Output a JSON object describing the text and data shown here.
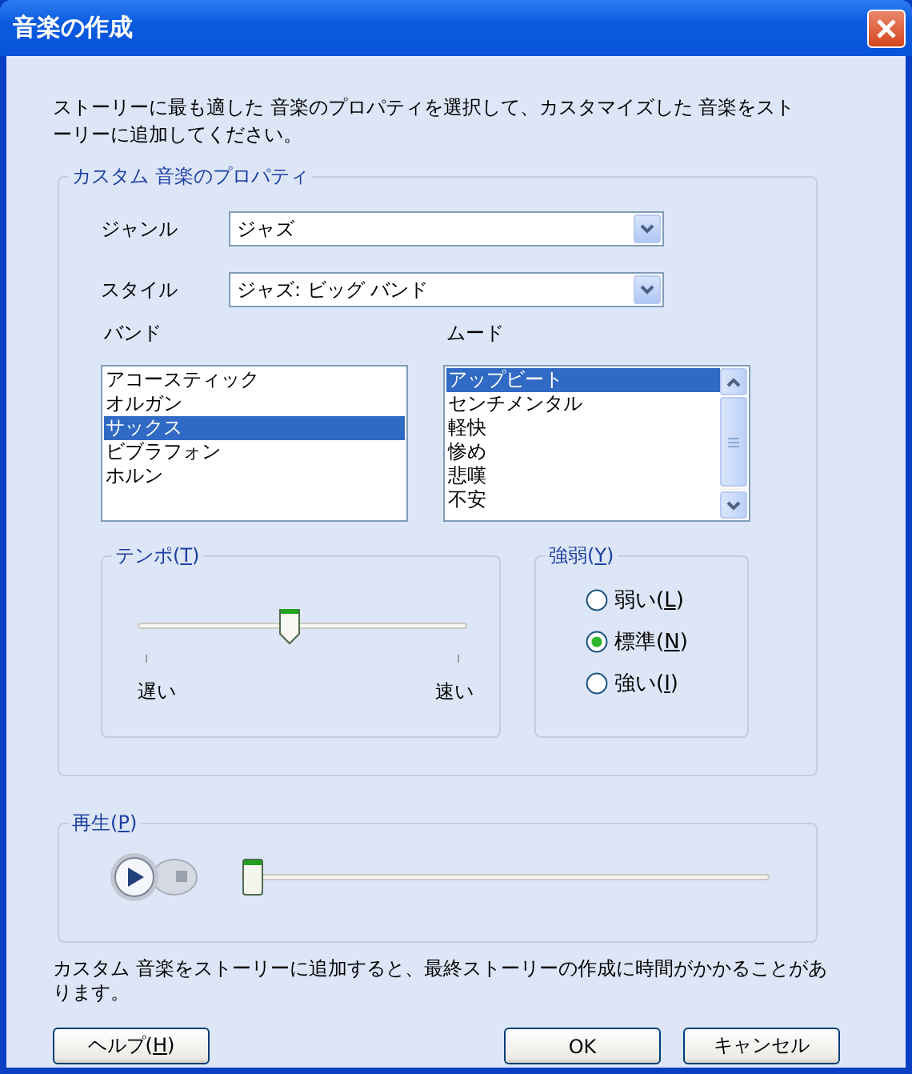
{
  "window": {
    "title": "音楽の作成"
  },
  "instructions": "ストーリーに最も適した 音楽のプロパティを選択して、カスタマイズした 音楽をストーリーに追加してください。",
  "properties": {
    "title": "カスタム 音楽のプロパティ",
    "genre": {
      "label": "ジャンル",
      "value": "ジャズ"
    },
    "style": {
      "label": "スタイル",
      "value": "ジャズ: ビッグ バンド"
    },
    "band": {
      "label": "バンド",
      "items": [
        {
          "label": "アコースティック",
          "selected": false
        },
        {
          "label": "オルガン",
          "selected": false
        },
        {
          "label": "サックス",
          "selected": true
        },
        {
          "label": "ビブラフォン",
          "selected": false
        },
        {
          "label": "ホルン",
          "selected": false
        }
      ]
    },
    "mood": {
      "label": "ムード",
      "items": [
        {
          "label": "アップビート",
          "selected": true
        },
        {
          "label": "センチメンタル",
          "selected": false
        },
        {
          "label": "軽快",
          "selected": false
        },
        {
          "label": "惨め",
          "selected": false
        },
        {
          "label": "悲嘆",
          "selected": false
        },
        {
          "label": "不安",
          "selected": false
        }
      ]
    },
    "tempo": {
      "title": "テンポ(T)",
      "mnemonic": true,
      "level": 0.46,
      "min_label": "遅い",
      "max_label": "速い"
    },
    "dynamics": {
      "title": "強弱(Y)",
      "mnemonic": true,
      "options": [
        {
          "label": "弱い(L)",
          "mnemonic": true,
          "selected": false
        },
        {
          "label": "標準(N)",
          "mnemonic": true,
          "selected": true
        },
        {
          "label": "強い(I)",
          "mnemonic": true,
          "selected": false
        }
      ]
    }
  },
  "playback": {
    "title": "再生(P)",
    "mnemonic": true,
    "level": 0
  },
  "note": "カスタム 音楽をストーリーに追加すると、最終ストーリーの作成に時間がかかることがあります。",
  "buttons": [
    {
      "label": "ヘルプ(H)",
      "mnemonic": true
    },
    {
      "label": "OK"
    },
    {
      "label": "キャンセル"
    }
  ]
}
